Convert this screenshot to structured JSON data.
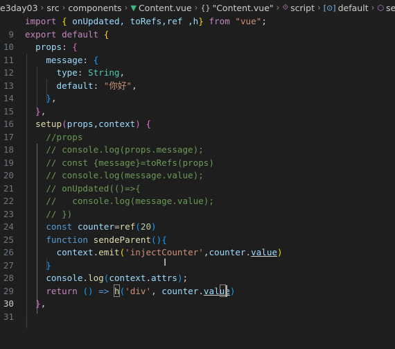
{
  "breadcrumb": {
    "root": "e3day03",
    "src": "src",
    "components": "components",
    "file": "Content.vue",
    "component": "\"Content.vue\"",
    "script": "script",
    "default": "default",
    "setup": "setup"
  },
  "editor": {
    "active_line": "30",
    "lines": [
      {
        "n": "9"
      },
      {
        "n": "10"
      },
      {
        "n": "11"
      },
      {
        "n": "12"
      },
      {
        "n": "13"
      },
      {
        "n": "14"
      },
      {
        "n": "15"
      },
      {
        "n": "16"
      },
      {
        "n": "17"
      },
      {
        "n": "18"
      },
      {
        "n": "19"
      },
      {
        "n": "20"
      },
      {
        "n": "21"
      },
      {
        "n": "22"
      },
      {
        "n": "23"
      },
      {
        "n": "24"
      },
      {
        "n": "25"
      },
      {
        "n": "26"
      },
      {
        "n": "27"
      },
      {
        "n": "28"
      },
      {
        "n": "29"
      },
      {
        "n": "30"
      },
      {
        "n": "31"
      }
    ],
    "tokens": {
      "import": "import",
      "imports": "onUpdated, toRefs,ref ,h",
      "from": "from",
      "vue": "\"vue\"",
      "export": "export",
      "default": "default",
      "props": "props",
      "message": "message",
      "type": "type",
      "string_type": "String",
      "default_key": "default",
      "nihao": "\"你好\"",
      "setup": "setup",
      "setup_args": "props,context",
      "c18": "//props",
      "c19": "// console.log(props.message);",
      "c20": "// const {message}=toRefs(props)",
      "c21": "// console.log(message.value);",
      "c22": "// onUpdated(()=>{",
      "c23": "//   console.log(message.value);",
      "c24": "// })",
      "const": "const",
      "counter": "counter",
      "ref": "ref",
      "twenty": "20",
      "function": "function",
      "sendeParent": "sendeParent",
      "context": "context",
      "emit": "emit",
      "injectCounter": "'injectCounter'",
      "value": "value",
      "console": "console",
      "log": "log",
      "attrs": "attrs",
      "return": "return",
      "h": "h",
      "div": "'div'"
    }
  },
  "colors": {
    "background": "#1e1e1e",
    "keyword": "#c586c0",
    "storage": "#569cd6",
    "function": "#dcdcaa",
    "variable": "#9cdcfe",
    "string": "#ce9178",
    "comment": "#6a9955",
    "vue_icon": "#41b883"
  }
}
